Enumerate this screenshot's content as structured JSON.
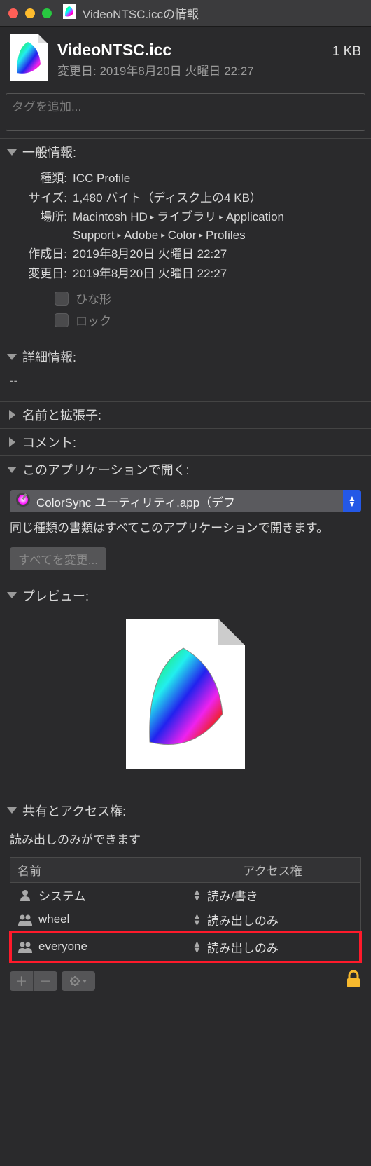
{
  "window": {
    "title": "VideoNTSC.iccの情報"
  },
  "header": {
    "filename": "VideoNTSC.icc",
    "size": "1 KB",
    "modified_label": "変更日:",
    "modified_value": "2019年8月20日 火曜日 22:27"
  },
  "tags": {
    "placeholder": "タグを追加..."
  },
  "sections": {
    "general": {
      "title": "一般情報:",
      "kind_k": "種類:",
      "kind_v": "ICC Profile",
      "size_k": "サイズ:",
      "size_v": "1,480 バイト（ディスク上の4 KB）",
      "where_k": "場所:",
      "where_parts": [
        "Macintosh HD",
        "ライブラリ",
        "Application Support",
        "Adobe",
        "Color",
        "Profiles"
      ],
      "created_k": "作成日:",
      "created_v": "2019年8月20日 火曜日 22:27",
      "modified_k": "変更日:",
      "modified_v": "2019年8月20日 火曜日 22:27",
      "stationery": "ひな形",
      "locked": "ロック"
    },
    "more": {
      "title": "詳細情報:",
      "body": "--"
    },
    "nameext": {
      "title": "名前と拡張子:"
    },
    "comments": {
      "title": "コメント:"
    },
    "openwith": {
      "title": "このアプリケーションで開く:",
      "app": "ColorSync ユーティリティ.app（デフ",
      "note": "同じ種類の書類はすべてこのアプリケーションで開きます。",
      "changeall": "すべてを変更..."
    },
    "preview": {
      "title": "プレビュー:"
    },
    "sharing": {
      "title": "共有とアクセス権:",
      "summary": "読み出しのみができます",
      "col_name": "名前",
      "col_priv": "アクセス権",
      "rows": [
        {
          "icon": "person",
          "name": "システム",
          "priv": "読み/書き"
        },
        {
          "icon": "group",
          "name": "wheel",
          "priv": "読み出しのみ"
        },
        {
          "icon": "group",
          "name": "everyone",
          "priv": "読み出しのみ",
          "highlight": true
        }
      ]
    }
  }
}
